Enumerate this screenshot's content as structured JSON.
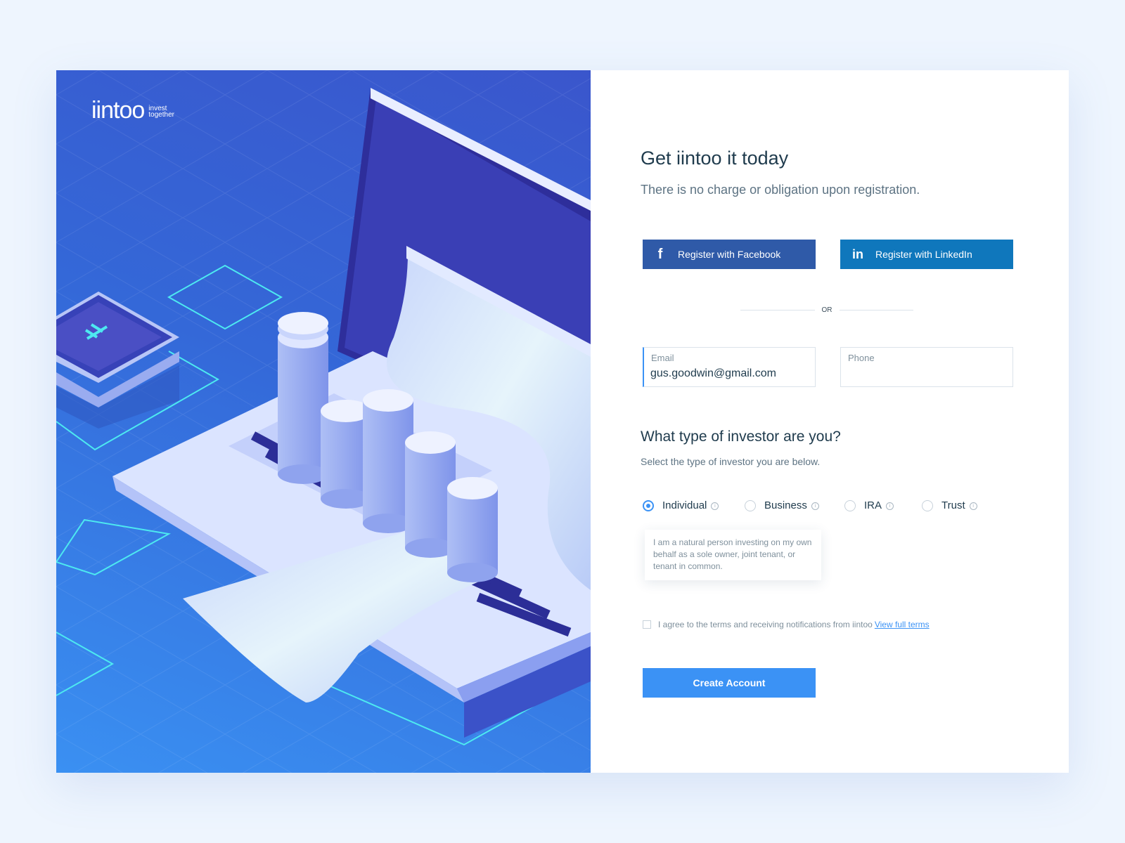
{
  "brand": {
    "logo_word": "iintoo",
    "tagline_1": "invest",
    "tagline_2": "together"
  },
  "form": {
    "title": "Get iintoo it today",
    "subtitle": "There is no charge or obligation upon registration.",
    "facebook_button": "Register with Facebook",
    "linkedin_button": "Register with LinkedIn",
    "or_label": "OR",
    "email": {
      "label": "Email",
      "value": "gus.goodwin@gmail.com"
    },
    "phone": {
      "label": "Phone",
      "value": ""
    }
  },
  "investor": {
    "title": "What type of investor are you?",
    "subtitle": "Select the type of investor you are below.",
    "options": [
      {
        "label": "Individual",
        "selected": true
      },
      {
        "label": "Business",
        "selected": false
      },
      {
        "label": "IRA",
        "selected": false
      },
      {
        "label": "Trust",
        "selected": false
      }
    ],
    "tooltip": "I am a natural person investing on my own behalf as a sole owner, joint tenant, or tenant in common."
  },
  "terms": {
    "text": "I agree to the terms and receiving notifications from iintoo",
    "link": "View full terms",
    "checked": false
  },
  "cta": {
    "label": "Create Account"
  },
  "colors": {
    "accent": "#3b92f5",
    "facebook": "#2f5aa8",
    "linkedin": "#0f77bc",
    "heading": "#1f3b4d",
    "hero_dark": "#3a56cc",
    "hero_light": "#3a90f2"
  },
  "icons": {
    "facebook": "facebook-icon",
    "linkedin": "linkedin-icon",
    "info": "info-icon"
  }
}
